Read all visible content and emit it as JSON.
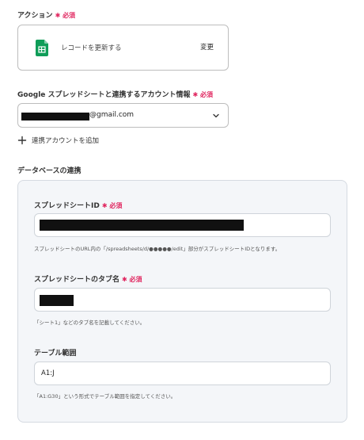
{
  "action": {
    "label": "アクション",
    "required_badge": "必須",
    "card_text": "レコードを更新する",
    "change_button": "変更",
    "icon": "google-sheets-icon",
    "icon_color": "#0f9d58"
  },
  "account": {
    "label": "Google スプレッドシートと連携するアカウント情報",
    "required_badge": "必須",
    "email_suffix": "@gmail.com",
    "add_label": "連携アカウントを追加"
  },
  "database": {
    "section_label": "データベースの連携",
    "spreadsheet_id": {
      "label": "スプレッドシートID",
      "required_badge": "必須",
      "hint": "スプレッドシートのURL内の「/spreadsheets/d/●●●●●/edit」部分がスプレッドシートIDとなります。"
    },
    "tab_name": {
      "label": "スプレッドシートのタブ名",
      "required_badge": "必須",
      "hint": "「シート1」などのタブ名を記載してください。"
    },
    "table_range": {
      "label": "テーブル範囲",
      "value": "A1:J",
      "hint": "「A1:G30」という形式でテーブル範囲を指定してください。"
    }
  },
  "colors": {
    "required": "#e0245e",
    "panel_bg": "#f4f6f9",
    "border": "#bdbdbd"
  }
}
